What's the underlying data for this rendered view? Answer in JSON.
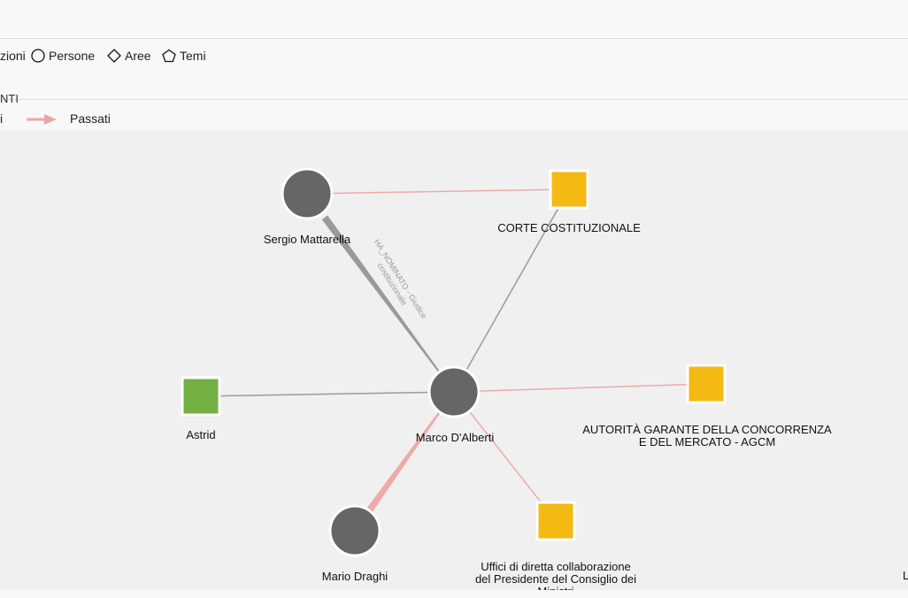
{
  "legend": {
    "types": [
      {
        "name": "zioni",
        "icon": "partial-label"
      },
      {
        "name": "Persone",
        "icon": "circle-outline-icon"
      },
      {
        "name": "Aree",
        "icon": "diamond-outline-icon"
      },
      {
        "name": "Temi",
        "icon": "pentagon-outline-icon"
      }
    ],
    "relations_title": "NTI",
    "relations": [
      {
        "name": "i",
        "style": "current-partial"
      },
      {
        "name": "Passati",
        "style": "past-arrow",
        "color": "#e8a7a7"
      }
    ]
  },
  "colors": {
    "person": "#666666",
    "institution": "#f5b914",
    "organization": "#72b043",
    "current_edge": "#9a9a9a",
    "past_edge": "#eeaaaa",
    "canvas": "#f0f0f0"
  },
  "graph": {
    "nodes": [
      {
        "id": "sergio",
        "label": "Sergio Mattarella",
        "kind": "person"
      },
      {
        "id": "corte",
        "label": "CORTE COSTITUZIONALE",
        "kind": "institution"
      },
      {
        "id": "marco",
        "label": "Marco D'Alberti",
        "kind": "person"
      },
      {
        "id": "astrid",
        "label": "Astrid",
        "kind": "organization"
      },
      {
        "id": "agcm",
        "label_lines": [
          "AUTORITÀ GARANTE DELLA CONCORRENZA",
          "E DEL MERCATO - AGCM"
        ],
        "kind": "institution"
      },
      {
        "id": "draghi",
        "label": "Mario Draghi",
        "kind": "person"
      },
      {
        "id": "uffici",
        "label_lines": [
          "Uffici di diretta collaborazione",
          "del Presidente del Consiglio dei",
          "Ministri"
        ],
        "kind": "institution"
      }
    ],
    "edges": [
      {
        "from": "sergio",
        "to": "corte",
        "status": "past"
      },
      {
        "from": "sergio",
        "to": "marco",
        "status": "current",
        "weight": "thick",
        "label_lines": [
          "HA_NOMINATO - Giudice",
          "costituzionale"
        ]
      },
      {
        "from": "corte",
        "to": "marco",
        "status": "current"
      },
      {
        "from": "astrid",
        "to": "marco",
        "status": "current"
      },
      {
        "from": "agcm",
        "to": "marco",
        "status": "past"
      },
      {
        "from": "draghi",
        "to": "marco",
        "status": "past",
        "weight": "thick"
      },
      {
        "from": "uffici",
        "to": "marco",
        "status": "past"
      }
    ],
    "edge_label": "HA_NOMINATO - Giudice costituzionale",
    "offscreen_label": "L"
  }
}
